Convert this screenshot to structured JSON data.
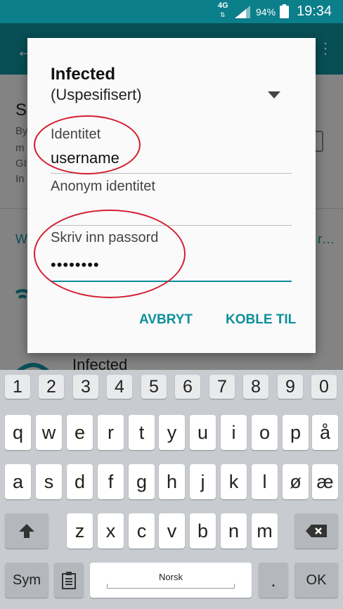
{
  "status_bar": {
    "network": "4G",
    "battery_text": "94%",
    "time": "19:34",
    "accent_color": "#0b7f8a"
  },
  "background": {
    "letter": "S",
    "lines": [
      "By",
      "m",
      "GI",
      "In"
    ],
    "section_label": "W",
    "section_right": "r…",
    "list_item": "Infected"
  },
  "dialog": {
    "title": "Infected",
    "security_value": "(Uspesifisert)",
    "identity": {
      "label": "Identitet",
      "value": "username"
    },
    "anonymous": {
      "label": "Anonym identitet",
      "value": ""
    },
    "password": {
      "label": "Skriv inn passord",
      "value": "••••••••"
    },
    "cancel_label": "AVBRYT",
    "connect_label": "KOBLE TIL",
    "accent_color": "#0d8f9b",
    "annotation_color": "#d31f2f"
  },
  "keyboard": {
    "number_row": [
      "1",
      "2",
      "3",
      "4",
      "5",
      "6",
      "7",
      "8",
      "9",
      "0"
    ],
    "row1": [
      "q",
      "w",
      "e",
      "r",
      "t",
      "y",
      "u",
      "i",
      "o",
      "p",
      "å"
    ],
    "row2": [
      "a",
      "s",
      "d",
      "f",
      "g",
      "h",
      "j",
      "k",
      "l",
      "ø",
      "æ"
    ],
    "row3": [
      "z",
      "x",
      "c",
      "v",
      "b",
      "n",
      "m"
    ],
    "shift_icon": "shift-arrow-icon",
    "backspace_icon": "backspace-icon",
    "sym_label": "Sym",
    "clipboard_icon": "clipboard-icon",
    "space_label": "Norsk",
    "period_label": ".",
    "ok_label": "OK"
  }
}
